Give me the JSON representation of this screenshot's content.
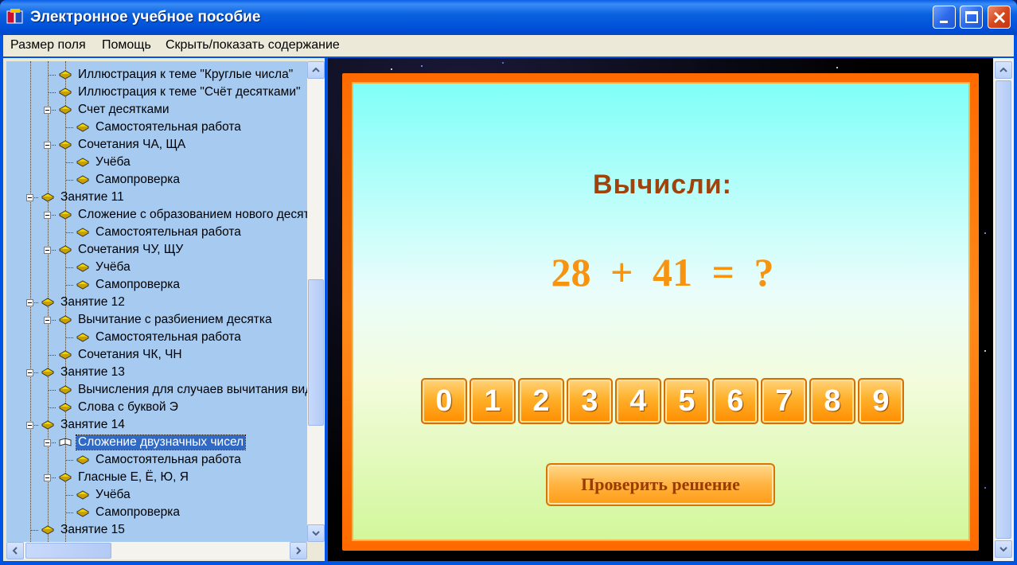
{
  "window": {
    "title": "Электронное учебное пособие"
  },
  "menu": {
    "items": [
      "Размер поля",
      "Помощь",
      "Скрыть/показать содержание"
    ]
  },
  "tree": {
    "items": [
      {
        "label": "Иллюстрация к теме \"Круглые числа\"",
        "level": 2
      },
      {
        "label": "Иллюстрация к теме \"Счёт десятками\"",
        "level": 2
      },
      {
        "label": "Счет десятками",
        "level": 2
      },
      {
        "label": "Самостоятельная работа",
        "level": 3
      },
      {
        "label": "Сочетания ЧА, ЩА",
        "level": 2
      },
      {
        "label": "Учёба",
        "level": 3
      },
      {
        "label": "Самопроверка",
        "level": 3
      },
      {
        "label": "Занятие 11",
        "level": 1
      },
      {
        "label": "Сложение с образованием нового десятка",
        "level": 2
      },
      {
        "label": "Самостоятельная работа",
        "level": 3
      },
      {
        "label": "Сочетания ЧУ, ЩУ",
        "level": 2
      },
      {
        "label": "Учёба",
        "level": 3
      },
      {
        "label": "Самопроверка",
        "level": 3
      },
      {
        "label": "Занятие 12",
        "level": 1
      },
      {
        "label": "Вычитание с разбиением десятка",
        "level": 2
      },
      {
        "label": "Самостоятельная работа",
        "level": 3
      },
      {
        "label": "Сочетания ЧК, ЧН",
        "level": 2
      },
      {
        "label": "Занятие 13",
        "level": 1
      },
      {
        "label": "Вычисления для случаев вычитания вида",
        "level": 2
      },
      {
        "label": "Слова с буквой Э",
        "level": 2
      },
      {
        "label": "Занятие 14",
        "level": 1
      },
      {
        "label": "Сложение двузначных чисел",
        "level": 2,
        "selected": true
      },
      {
        "label": "Самостоятельная работа",
        "level": 3
      },
      {
        "label": "Гласные Е, Ё, Ю, Я",
        "level": 2
      },
      {
        "label": "Учёба",
        "level": 3
      },
      {
        "label": "Самопроверка",
        "level": 3
      },
      {
        "label": "Занятие 15",
        "level": 1
      }
    ]
  },
  "exercise": {
    "title": "Вычисли:",
    "expression": "28 + 41 = ?",
    "digits": [
      "0",
      "1",
      "2",
      "3",
      "4",
      "5",
      "6",
      "7",
      "8",
      "9"
    ],
    "check_label": "Проверить решение"
  },
  "colors": {
    "title_bar": "#0054E3",
    "tree_bg": "#A6CAF0",
    "selection": "#316AC5",
    "accent_orange": "#FF8A1A",
    "heading_brown": "#A0420A",
    "expression_orange": "#F7930E"
  }
}
